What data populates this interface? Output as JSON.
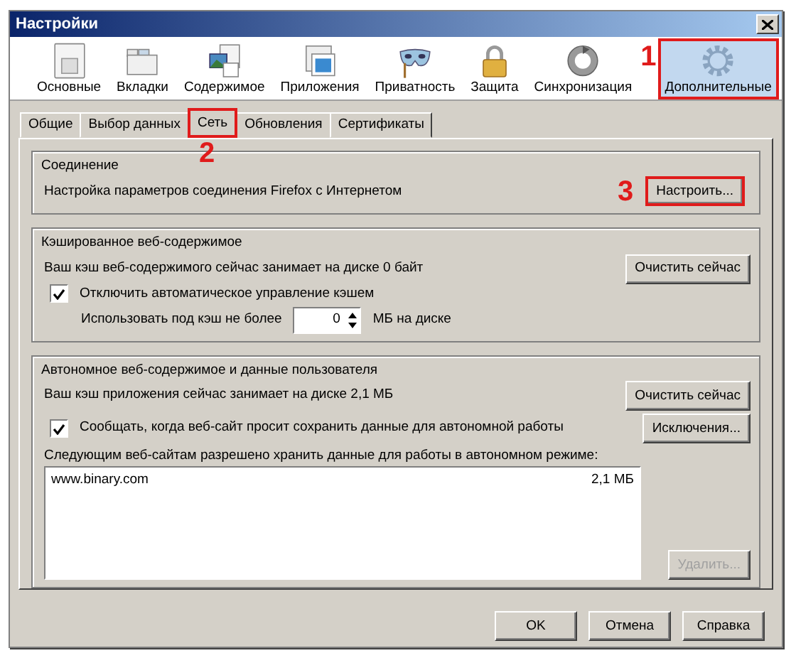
{
  "window": {
    "title": "Настройки"
  },
  "toolbar": [
    {
      "label": "Основные",
      "kind": "general",
      "selected": false,
      "highlighted": false
    },
    {
      "label": "Вкладки",
      "kind": "tabs",
      "selected": false,
      "highlighted": false
    },
    {
      "label": "Содержимое",
      "kind": "content",
      "selected": false,
      "highlighted": false
    },
    {
      "label": "Приложения",
      "kind": "apps",
      "selected": false,
      "highlighted": false
    },
    {
      "label": "Приватность",
      "kind": "privacy",
      "selected": false,
      "highlighted": false
    },
    {
      "label": "Защита",
      "kind": "security",
      "selected": false,
      "highlighted": false
    },
    {
      "label": "Синхронизация",
      "kind": "sync",
      "selected": false,
      "highlighted": false
    },
    {
      "label": "Дополнительные",
      "kind": "advanced",
      "selected": true,
      "highlighted": true,
      "callout": "1"
    }
  ],
  "tabs": [
    {
      "label": "Общие",
      "selected": false,
      "highlighted": false
    },
    {
      "label": "Выбор данных",
      "selected": false,
      "highlighted": false
    },
    {
      "label": "Сеть",
      "selected": true,
      "highlighted": true,
      "callout": "2"
    },
    {
      "label": "Обновления",
      "selected": false,
      "highlighted": false
    },
    {
      "label": "Сертификаты",
      "selected": false,
      "highlighted": false
    }
  ],
  "connection": {
    "legend": "Соединение",
    "text": "Настройка параметров соединения Firefox с Интернетом",
    "button": {
      "label": "Настроить...",
      "highlighted": true,
      "callout": "3"
    }
  },
  "cache": {
    "legend": "Кэшированное веб-содержимое",
    "text": "Ваш кэш веб-содержимого сейчас занимает на диске 0 байт",
    "clear_button": "Очистить сейчас",
    "checkbox": {
      "label": "Отключить автоматическое управление кэшем",
      "checked": true
    },
    "limit": {
      "label": "Использовать под кэш не более",
      "value": "0",
      "unit": "МБ на диске"
    }
  },
  "offline": {
    "legend": "Автономное веб-содержимое и данные пользователя",
    "text": "Ваш кэш приложения сейчас занимает на диске 2,1 МБ",
    "clear_button": "Очистить сейчас",
    "checkbox": {
      "label": "Сообщать, когда веб-сайт просит сохранить данные для автономной работы",
      "checked": true
    },
    "exceptions_button": "Исключения...",
    "list_label": "Следующим веб-сайтам разрешено хранить данные для работы в автономном режиме:",
    "sites": [
      {
        "site": "www.binary.com",
        "size": "2,1 МБ"
      }
    ],
    "remove_button": {
      "label": "Удалить...",
      "disabled": true
    }
  },
  "buttons": [
    "OK",
    "Отмена",
    "Справка"
  ]
}
